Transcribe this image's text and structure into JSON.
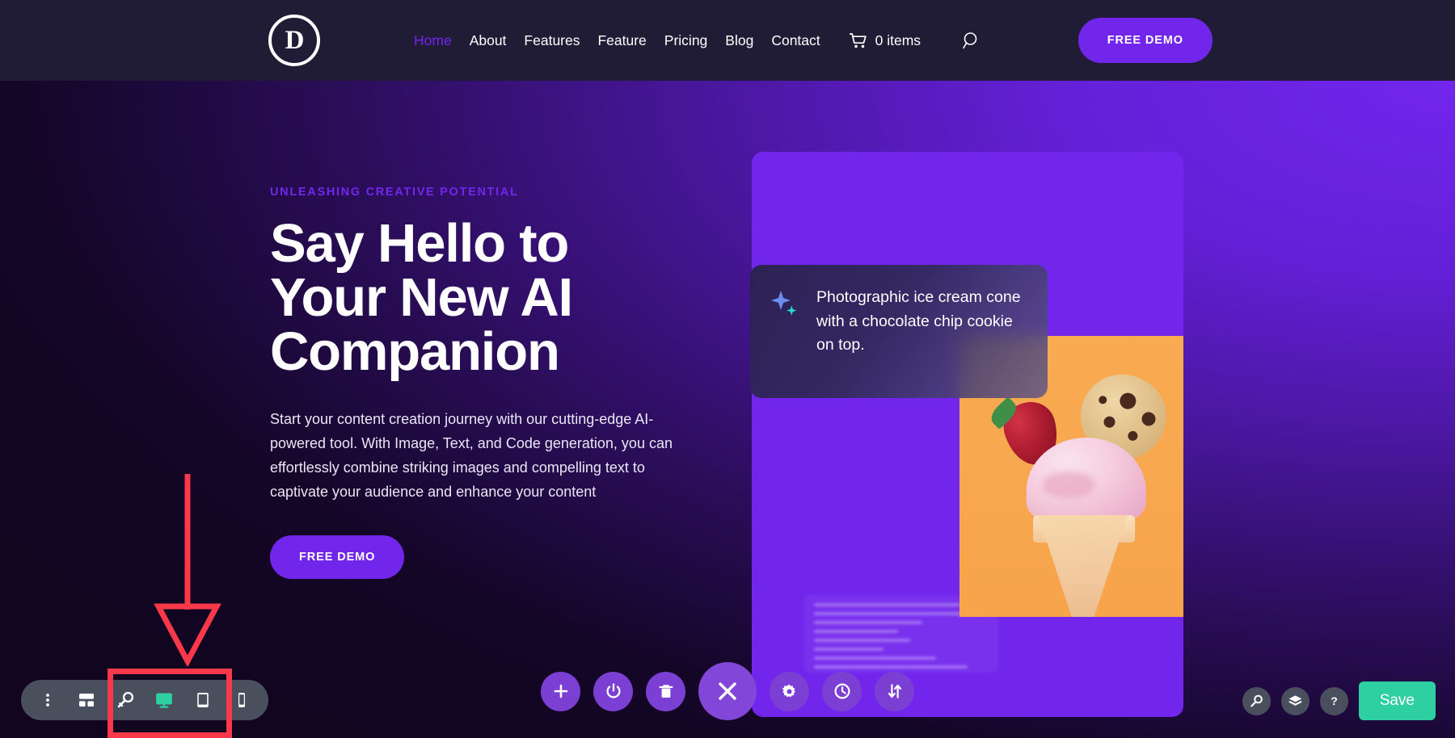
{
  "navbar": {
    "logo_letter": "D",
    "logo_name": "divi-logo",
    "links": [
      {
        "label": "Home",
        "active": true
      },
      {
        "label": "About",
        "active": false
      },
      {
        "label": "Features",
        "active": false
      },
      {
        "label": "Feature",
        "active": false
      },
      {
        "label": "Pricing",
        "active": false
      },
      {
        "label": "Blog",
        "active": false
      },
      {
        "label": "Contact",
        "active": false
      }
    ],
    "cart_items": "0 items",
    "cart_icon": "shopping-cart-icon",
    "search_icon": "search-icon",
    "cta_label": "FREE DEMO",
    "active_color": "#7226ec",
    "background": "#201c36"
  },
  "hero": {
    "eyebrow": "UNLEASHING CREATIVE POTENTIAL",
    "title_line1": "Say Hello to",
    "title_line2": "Your New AI",
    "title_line3": "Companion",
    "body": "Start your content creation journey with our cutting-edge AI-powered tool. With Image, Text, and Code generation, you can effortlessly combine striking images and compelling text to captivate your audience and enhance your content",
    "cta_label": "FREE DEMO",
    "accent_color": "#7226ec",
    "background_gradient_from": "#7226ec",
    "background_gradient_to": "#110520"
  },
  "showcase": {
    "card_color": "#7226ec",
    "photo_background": "#f9ab52",
    "photo_alt": "ice-cream-cone-photo",
    "prompt": {
      "sparkle_icon": "ai-sparkle-icon",
      "text": "Photographic ice cream cone with a chocolate chip cookie on top."
    }
  },
  "annotation": {
    "arrow_color": "#f9394a",
    "box_color": "#f9394a",
    "arrow_name": "red-annotation-arrow",
    "box_name": "red-annotation-box"
  },
  "builder_bar": {
    "left_tools": [
      {
        "name": "more-options-icon",
        "label": "More options"
      },
      {
        "name": "wireframe-view-icon",
        "label": "Wireframe view"
      },
      {
        "name": "zoom-out-view-icon",
        "label": "Zoom out view"
      },
      {
        "name": "desktop-view-icon",
        "label": "Desktop view",
        "active": true
      },
      {
        "name": "tablet-view-icon",
        "label": "Tablet view",
        "active": false
      },
      {
        "name": "phone-view-icon",
        "label": "Phone view",
        "active": false
      }
    ],
    "center_tools": [
      {
        "name": "add-section-icon",
        "label": "Add section"
      },
      {
        "name": "power-toggle-icon",
        "label": "Enable / disable"
      },
      {
        "name": "trash-icon",
        "label": "Delete"
      },
      {
        "name": "close-builder-icon",
        "label": "Close builder"
      },
      {
        "name": "settings-gear-icon",
        "label": "Settings"
      },
      {
        "name": "history-clock-icon",
        "label": "Editing history"
      },
      {
        "name": "responsive-sort-icon",
        "label": "Portability"
      }
    ],
    "right_tools": [
      {
        "name": "search-icon",
        "label": "Search"
      },
      {
        "name": "layers-icon",
        "label": "Layers"
      },
      {
        "name": "help-icon",
        "label": "Help"
      }
    ],
    "save_label": "Save",
    "save_color": "#2ecfa0",
    "bar_color": "#4a4f5e",
    "center_button_color": "#7b3fd4"
  }
}
